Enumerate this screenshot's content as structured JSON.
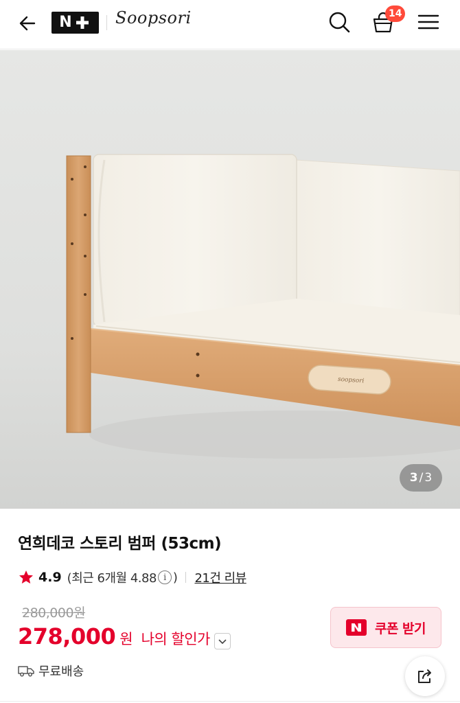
{
  "header": {
    "nplus_logo_text": "N",
    "brand_text": "Soopsori",
    "cart_count": "14"
  },
  "hero": {
    "image_description_alt": "연희데코 스토리 범퍼",
    "bed_tag_text": "soopsori",
    "counter_current": "3",
    "counter_separator": "/",
    "counter_total": "3"
  },
  "product": {
    "title": "연희데코 스토리 범퍼 (53cm)",
    "rating": "4.9",
    "recent_prefix": "(최근 6개월 4.88",
    "recent_suffix": ")",
    "info_glyph": "i",
    "review_link": "21건 리뷰",
    "original_price": "280,000원",
    "price": "278,000",
    "currency": "원",
    "my_discount_label": "나의 할인가",
    "coupon_label": "쿠폰 받기",
    "coupon_icon_text": "N",
    "shipping_label": "무료배송"
  },
  "colors": {
    "accent": "#e4002b",
    "badge": "#ff4a3a",
    "coupon_bg": "#fde8eb"
  },
  "icons": {
    "back": "arrow-left-icon",
    "search": "search-icon",
    "cart": "shopping-bag-icon",
    "menu": "hamburger-menu-icon",
    "star": "star-icon",
    "info": "info-icon",
    "chevron": "chevron-down-icon",
    "truck": "truck-icon",
    "share": "share-icon"
  }
}
